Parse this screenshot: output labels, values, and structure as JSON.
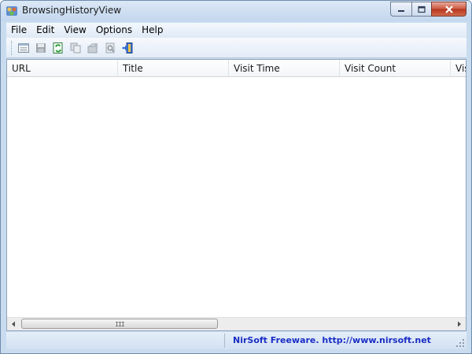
{
  "window": {
    "title": "BrowsingHistoryView",
    "app_icon": "browsing-history-app-icon",
    "controls": [
      "minimize-icon",
      "maximize-icon",
      "close-icon"
    ]
  },
  "menu": {
    "items": [
      {
        "label": "File"
      },
      {
        "label": "Edit"
      },
      {
        "label": "View"
      },
      {
        "label": "Options"
      },
      {
        "label": "Help"
      }
    ]
  },
  "toolbar": {
    "buttons": [
      {
        "icon": "html-report-icon"
      },
      {
        "icon": "save-icon"
      },
      {
        "icon": "refresh-icon"
      },
      {
        "icon": "copy-icon"
      },
      {
        "icon": "properties-icon"
      },
      {
        "icon": "find-icon"
      },
      {
        "icon": "exit-icon"
      }
    ]
  },
  "list": {
    "columns": [
      "URL",
      "Title",
      "Visit Time",
      "Visit Count",
      "Visited From"
    ],
    "rows": []
  },
  "scrollbar": {
    "grip": "III"
  },
  "status": {
    "left": "",
    "credit": "NirSoft Freeware.  http://www.nirsoft.net"
  },
  "colors": {
    "status_link": "#1a2ec4",
    "frame": "#c9dcef"
  }
}
